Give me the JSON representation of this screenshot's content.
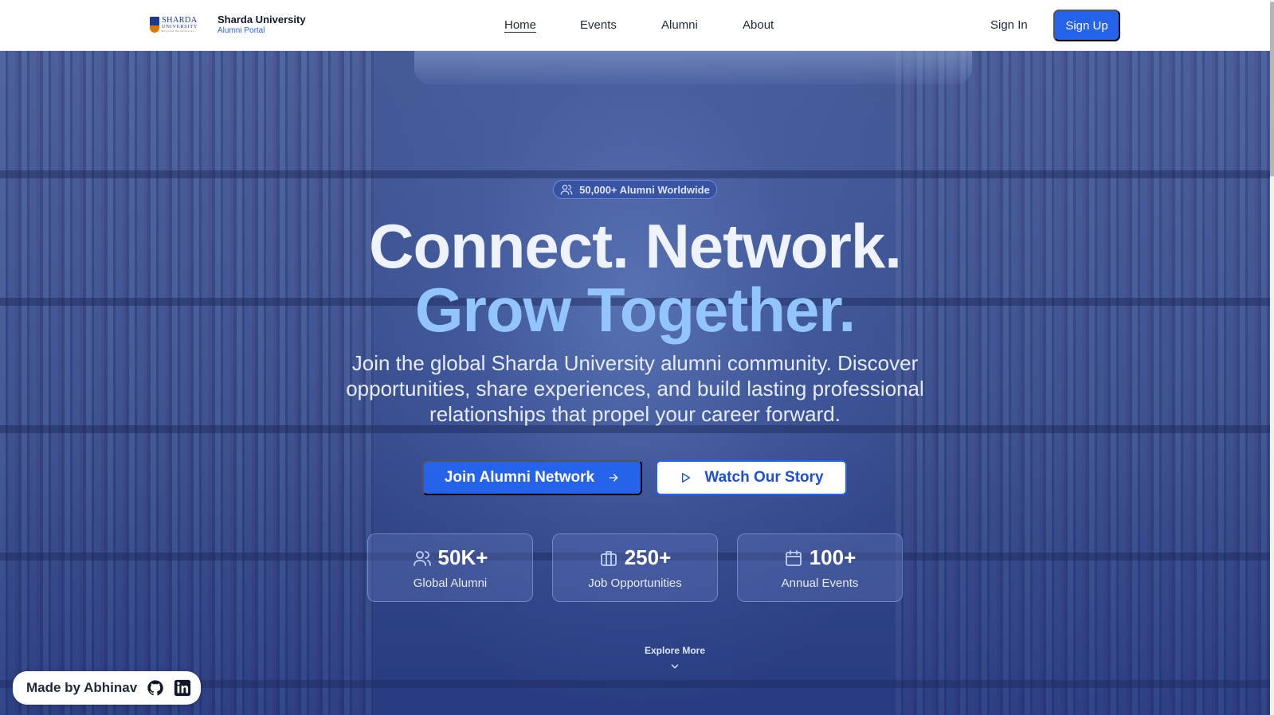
{
  "header": {
    "logo_text": {
      "line1": "SHARDA",
      "line2": "UNIVERSITY",
      "line3": "Beyond Boundaries"
    },
    "brand_title": "Sharda University",
    "brand_subtitle": "Alumni Portal",
    "nav": {
      "home": "Home",
      "events": "Events",
      "alumni": "Alumni",
      "about": "About"
    },
    "active_nav": "Home",
    "sign_in": "Sign In",
    "sign_up": "Sign Up"
  },
  "hero": {
    "badge": "50,000+ Alumni Worldwide",
    "headline_line1": "Connect. Network.",
    "headline_line2": "Grow Together.",
    "description": "Join the global Sharda University alumni community. Discover opportunities, share experiences, and build lasting professional relationships that propel your career forward.",
    "primary_cta": "Join Alumni Network",
    "secondary_cta": "Watch Our Story",
    "stats": [
      {
        "value": "50K+",
        "label": "Global Alumni",
        "icon": "users-icon"
      },
      {
        "value": "250+",
        "label": "Job Opportunities",
        "icon": "briefcase-icon"
      },
      {
        "value": "100+",
        "label": "Annual Events",
        "icon": "calendar-icon"
      }
    ],
    "explore_more": "Explore More"
  },
  "footer_badge": {
    "text": "Made by Abhinav",
    "icons": [
      "github-icon",
      "linkedin-icon"
    ]
  },
  "colors": {
    "primary": "#2563eb",
    "accent_light": "#93c5fd",
    "hero_bg": "#3c5292",
    "white": "#ffffff"
  }
}
